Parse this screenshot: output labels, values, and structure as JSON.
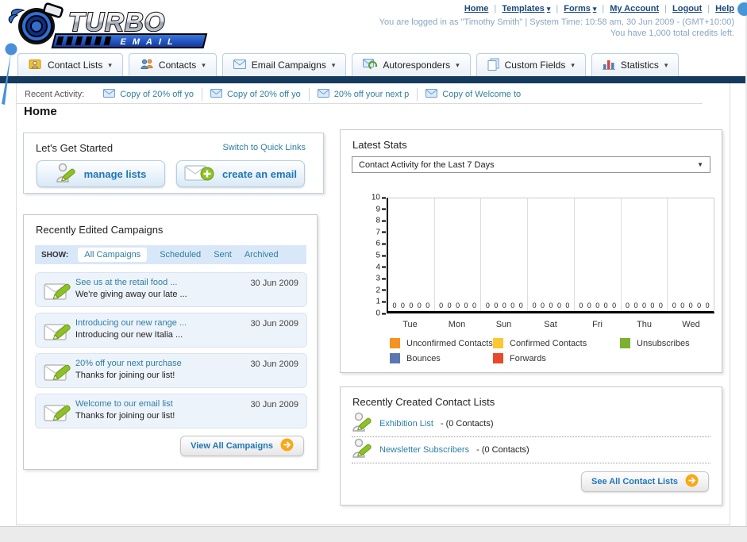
{
  "page": {
    "heading": "Home"
  },
  "header": {
    "logo_title": "TURBO",
    "logo_subtitle": "EMAIL",
    "nav_links": [
      {
        "label": "Home",
        "dropdown": false
      },
      {
        "label": "Templates",
        "dropdown": true
      },
      {
        "label": "Forms",
        "dropdown": true
      },
      {
        "label": "My Account",
        "dropdown": false
      },
      {
        "label": "Logout",
        "dropdown": false
      },
      {
        "label": "Help",
        "dropdown": false
      }
    ],
    "login_status": "You are logged in as \"Timothy Smith\" | System Time: 10:58 am, 30 Jun 2009 - (GMT+10:00)",
    "credits_note": "You have 1,000 total credits left."
  },
  "nav_tabs": [
    {
      "label": "Contact Lists",
      "icon": "contact-lists-icon"
    },
    {
      "label": "Contacts",
      "icon": "contacts-icon"
    },
    {
      "label": "Email Campaigns",
      "icon": "email-campaigns-icon"
    },
    {
      "label": "Autoresponders",
      "icon": "autoresponders-icon"
    },
    {
      "label": "Custom Fields",
      "icon": "custom-fields-icon"
    },
    {
      "label": "Statistics",
      "icon": "statistics-icon"
    }
  ],
  "recent_activity": {
    "label": "Recent Activity:",
    "items": [
      "Copy of 20% off yo",
      "Copy of 20% off yo",
      "20% off your next p",
      "Copy of Welcome to"
    ]
  },
  "get_started": {
    "title": "Let's Get Started",
    "switch_link": "Switch to Quick Links",
    "buttons": [
      {
        "label": "manage lists",
        "icon": "manage-lists-icon"
      },
      {
        "label": "create an email",
        "icon": "create-email-icon"
      }
    ]
  },
  "campaigns": {
    "title": "Recently Edited Campaigns",
    "show_label": "SHOW:",
    "filters": [
      {
        "label": "All Campaigns",
        "active": true
      },
      {
        "label": "Scheduled",
        "active": false
      },
      {
        "label": "Sent",
        "active": false
      },
      {
        "label": "Archived",
        "active": false
      }
    ],
    "items": [
      {
        "title": "See us at the retail food ...",
        "subtitle": "We're giving away our late ...",
        "date": "30 Jun 2009"
      },
      {
        "title": "Introducing our new range ...",
        "subtitle": "Introducing our new Italia ...",
        "date": "30 Jun 2009"
      },
      {
        "title": "20% off your next purchase",
        "subtitle": "Thanks for joining our list!",
        "date": "30 Jun 2009"
      },
      {
        "title": "Welcome to our email list",
        "subtitle": "Thanks for joining our list!",
        "date": "30 Jun 2009"
      }
    ],
    "view_all_label": "View All Campaigns"
  },
  "latest_stats": {
    "title": "Latest Stats",
    "dropdown_value": "Contact Activity for the Last 7 Days"
  },
  "chart_data": {
    "type": "bar",
    "title": "Contact Activity for the Last 7 Days",
    "categories": [
      "Tue",
      "Mon",
      "Sun",
      "Sat",
      "Fri",
      "Thu",
      "Wed"
    ],
    "series": [
      {
        "name": "Unconfirmed Contacts",
        "color": "#f6921e",
        "values": [
          0,
          0,
          0,
          0,
          0,
          0,
          0
        ]
      },
      {
        "name": "Confirmed Contacts",
        "color": "#fdc72f",
        "values": [
          0,
          0,
          0,
          0,
          0,
          0,
          0
        ]
      },
      {
        "name": "Unsubscribes",
        "color": "#7cb02e",
        "values": [
          0,
          0,
          0,
          0,
          0,
          0,
          0
        ]
      },
      {
        "name": "Bounces",
        "color": "#5b76b2",
        "values": [
          0,
          0,
          0,
          0,
          0,
          0,
          0
        ]
      },
      {
        "name": "Forwards",
        "color": "#e8492b",
        "values": [
          0,
          0,
          0,
          0,
          0,
          0,
          0
        ]
      }
    ],
    "ylim": [
      0,
      10
    ],
    "yticks": [
      10,
      9,
      8,
      7,
      6,
      5,
      4,
      3,
      2,
      1,
      0
    ],
    "grid": "vertical group separators only",
    "legend_position": "bottom"
  },
  "contact_lists": {
    "title": "Recently Created Contact Lists",
    "items": [
      {
        "name": "Exhibition List",
        "detail": "- (0 Contacts)"
      },
      {
        "name": "Newsletter Subscribers",
        "detail": "- (0 Contacts)"
      }
    ],
    "see_all_label": "See All Contact Lists"
  },
  "colors": {
    "navy_bar": "#153a5e",
    "link_blue": "#19497e",
    "accent_teal": "#2e7ea3",
    "button_text_blue": "#2076b8",
    "arrow_orange": "#f9a819",
    "pencil_green": "#8ec126"
  }
}
